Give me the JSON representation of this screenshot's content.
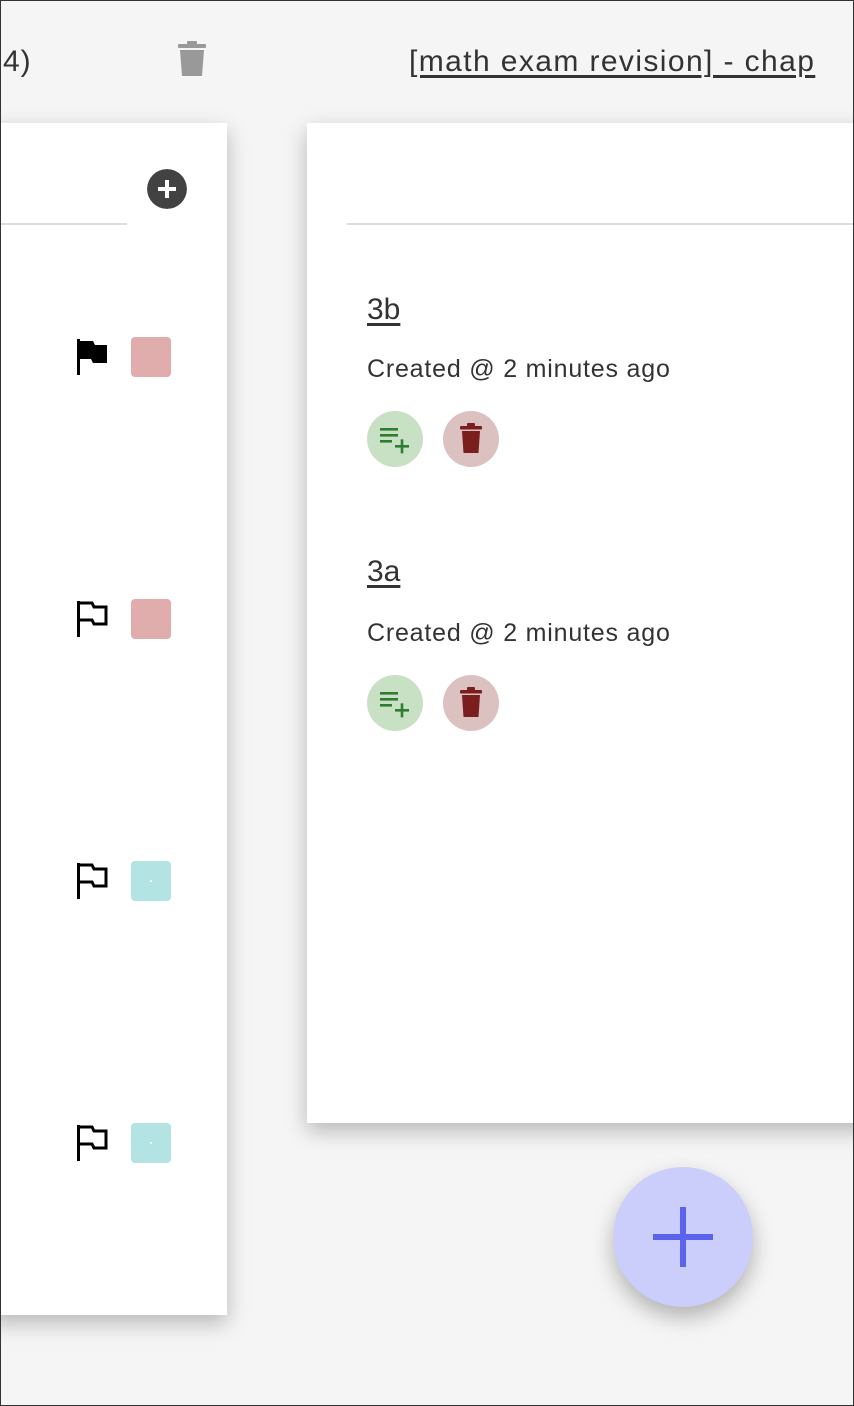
{
  "header": {
    "left_text": "4)",
    "title": "[math exam revision] - chap"
  },
  "left_panel": {
    "items": [
      {
        "flag": "flag-filled-icon",
        "color": "#e0acac"
      },
      {
        "flag": "flag-outline-icon",
        "color": "#e0acac"
      },
      {
        "flag": "flag-outline-icon",
        "color": "#b3e3e3"
      },
      {
        "flag": "flag-outline-icon",
        "color": "#b3e3e3"
      }
    ]
  },
  "notes": [
    {
      "title": "3b",
      "created": "Created @ 2 minutes ago"
    },
    {
      "title": "3a",
      "created": "Created @ 2 minutes ago"
    }
  ],
  "colors": {
    "add_list_icon": "#2e7d32",
    "delete_icon": "#7b1e1e",
    "fab_icon": "#5b63ec"
  },
  "icons": {
    "top_trash": "trash-icon",
    "panel_add": "add-circle-icon",
    "note_add_list": "playlist-add-icon",
    "note_delete": "delete-icon",
    "fab": "plus-icon"
  }
}
